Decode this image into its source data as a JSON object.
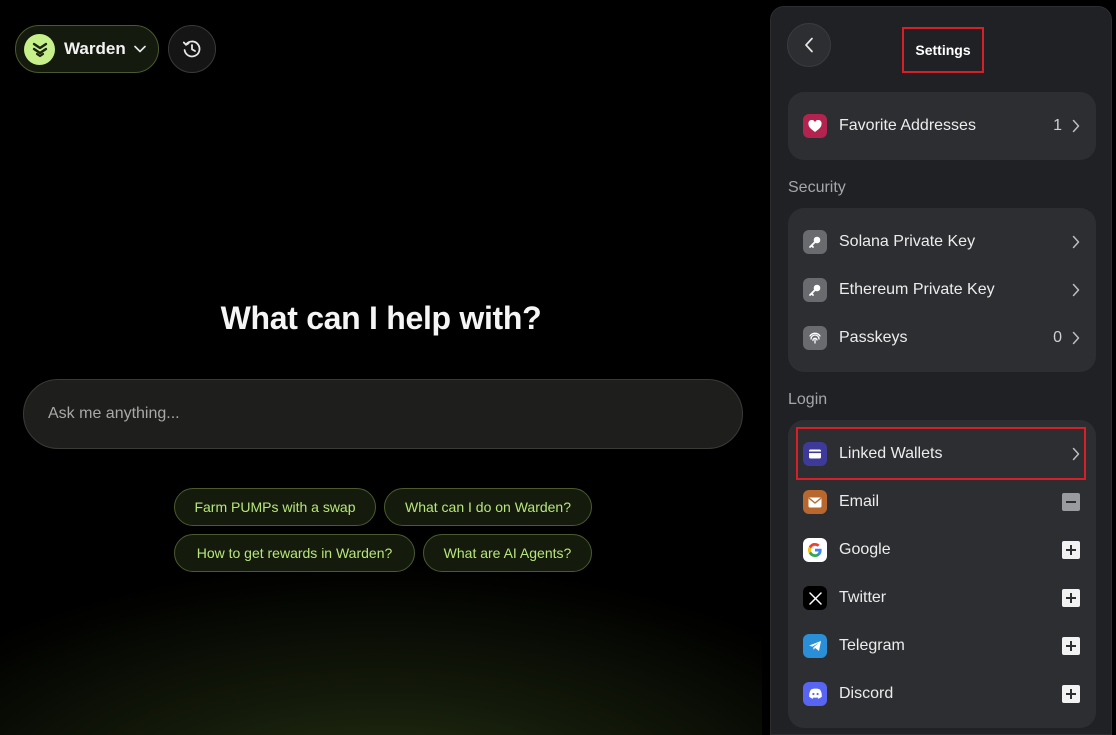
{
  "header": {
    "brand_name": "Warden"
  },
  "hero": {
    "title": "What can I help with?"
  },
  "ask": {
    "placeholder": "Ask me anything..."
  },
  "suggestions": [
    "Farm PUMPs with a swap",
    "What can I do on Warden?",
    "How to get rewards in Warden?",
    "What are AI Agents?"
  ],
  "settings": {
    "title": "Settings",
    "favorites": {
      "label": "Favorite Addresses",
      "count": "1"
    },
    "security": {
      "label": "Security",
      "items": [
        {
          "label": "Solana Private Key"
        },
        {
          "label": "Ethereum Private Key"
        },
        {
          "label": "Passkeys",
          "count": "0"
        }
      ]
    },
    "login": {
      "label": "Login",
      "items": [
        {
          "label": "Linked Wallets"
        },
        {
          "label": "Email"
        },
        {
          "label": "Google"
        },
        {
          "label": "Twitter"
        },
        {
          "label": "Telegram"
        },
        {
          "label": "Discord"
        }
      ]
    }
  },
  "colors": {
    "accent": "#c6f08a",
    "chip_text": "#b7e67a",
    "highlight": "#d61f26",
    "panel_bg": "#202124",
    "card_bg": "#2d2e31"
  }
}
